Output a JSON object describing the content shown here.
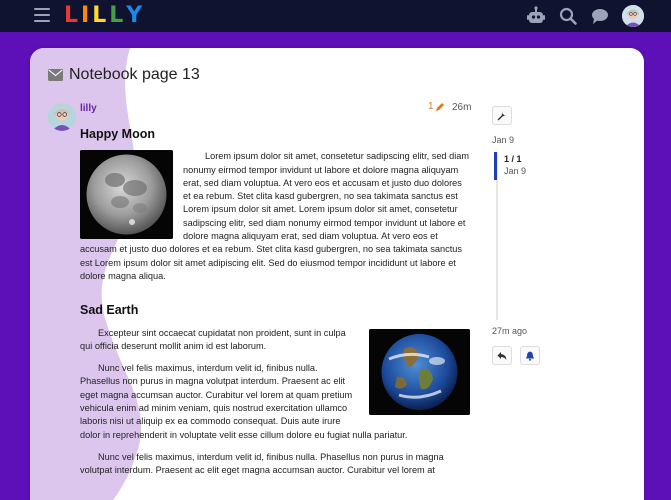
{
  "header": {
    "logo_letters": [
      "L",
      "I",
      "L",
      "L",
      "Y"
    ],
    "logo_colors": [
      "#e53935",
      "#fb8c00",
      "#fdd835",
      "#43a047",
      "#1e88e5"
    ],
    "icons": [
      "hamburger-icon",
      "robot-icon",
      "search-icon",
      "chat-icon",
      "user-avatar"
    ]
  },
  "topic": {
    "title": "Notebook page 13",
    "title_icon": "envelope-icon"
  },
  "post": {
    "username": "lilly",
    "edit_count": "1",
    "age": "26m",
    "section1_title": "Happy Moon",
    "section1_text": "Lorem ipsum dolor sit amet, consetetur sadipscing elitr, sed diam nonumy eirmod tempor invidunt ut labore et dolore magna aliquyam erat, sed diam voluptua. At vero eos et accusam et justo duo dolores et ea rebum. Stet clita kasd gubergren, no sea takimata sanctus est Lorem ipsum dolor sit amet. Lorem ipsum dolor sit amet, consetetur sadipscing elitr, sed diam nonumy eirmod tempor invidunt ut labore et dolore magna aliquyam erat, sed diam voluptua. At vero eos et accusam et justo duo dolores et ea rebum. Stet clita kasd gubergren, no sea takimata sanctus est Lorem ipsum dolor sit amet adipiscing elit. Sed do eiusmod tempor incididunt ut labore et dolore magna aliqua.",
    "section2_title": "Sad Earth",
    "section2_p1": "Excepteur sint occaecat cupidatat non proident, sunt in culpa qui officia deserunt mollit anim id est laborum.",
    "section2_p2": "Nunc vel felis maximus, interdum velit id, finibus nulla. Phasellus non purus in magna volutpat interdum. Praesent ac elit eget magna accumsan auctor. Curabitur vel lorem at quam pretium vehicula enim ad minim veniam, quis nostrud exercitation ullamco laboris nisi ut aliquip ex ea commodo consequat. Duis aute irure dolor in reprehenderit in voluptate velit esse cillum dolore eu fugiat nulla pariatur.",
    "section2_p3": "Nunc vel felis maximus, interdum velit id, finibus nulla. Phasellus non purus in magna volutpat interdum. Praesent ac elit eget magna accumsan auctor. Curabitur vel lorem at"
  },
  "timeline": {
    "start_date": "Jan 9",
    "position": "1 / 1",
    "position_date": "Jan 9",
    "last_activity": "27m ago"
  },
  "colors": {
    "accent_purple": "#6b21a8",
    "timeline_blue": "#1e3fb6",
    "edit_orange": "#e0791e",
    "header_bg": "#0f1330"
  }
}
